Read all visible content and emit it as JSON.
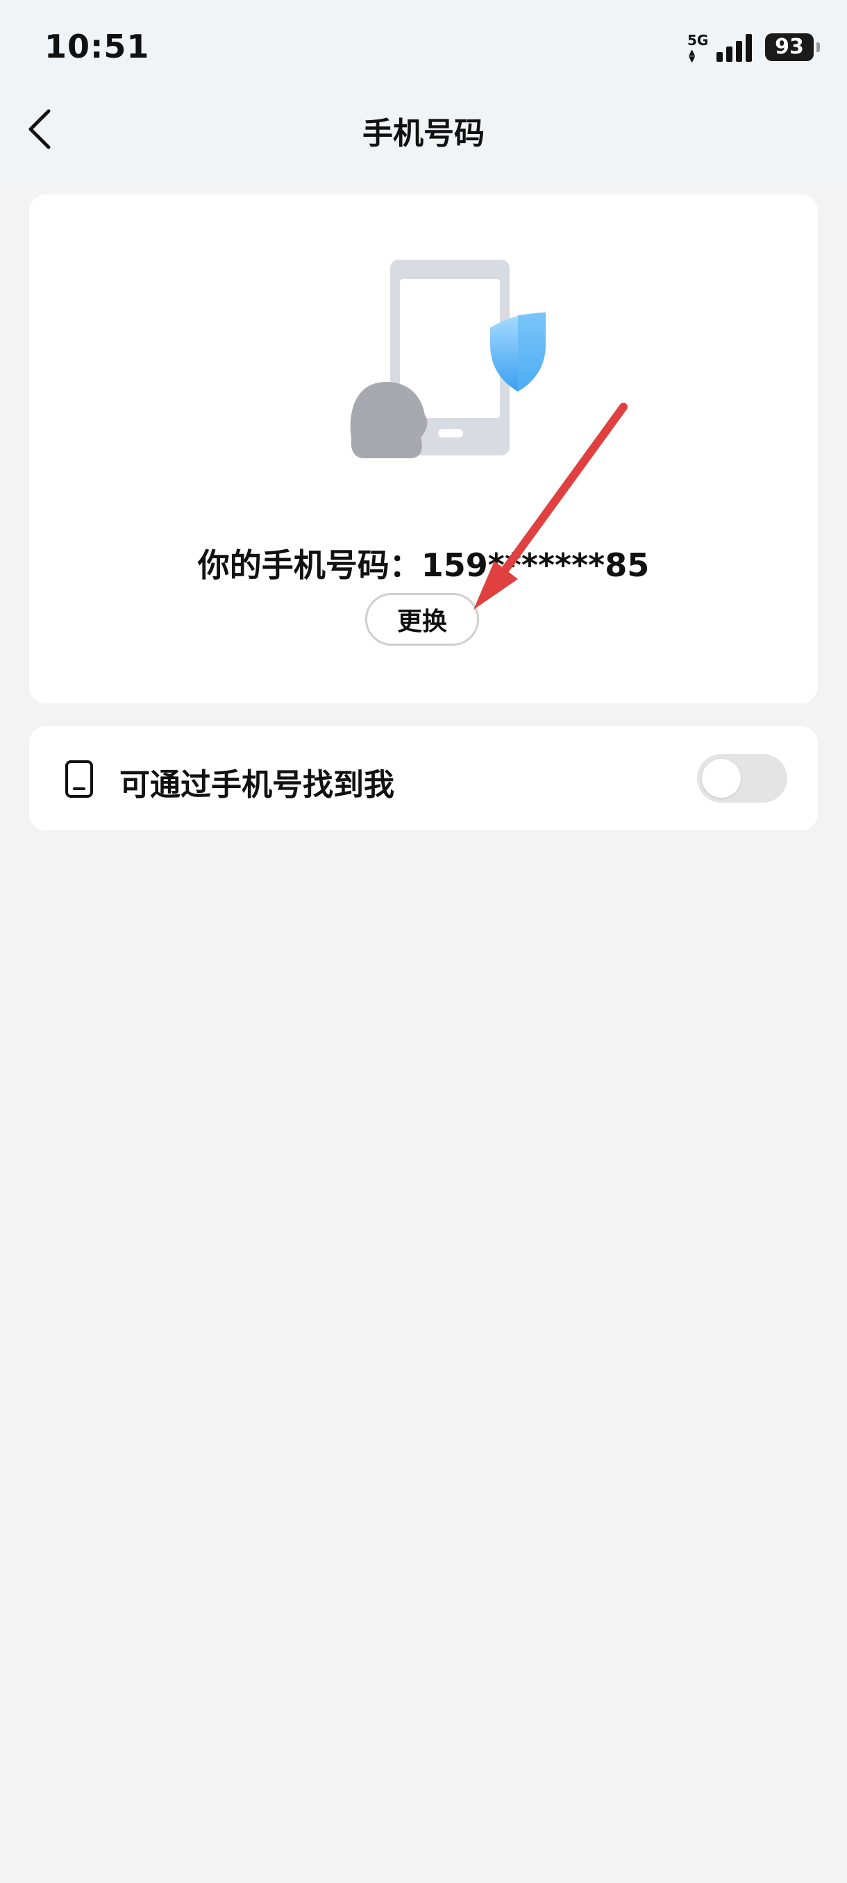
{
  "status_bar": {
    "time": "10:51",
    "network": "5G",
    "battery": "93"
  },
  "header": {
    "title": "手机号码",
    "back_icon": "chevron-left-icon"
  },
  "phone_card": {
    "illustration": "phone-shield-penguin-illustration",
    "phone_text": "你的手机号码：159*******85",
    "change_label": "更换"
  },
  "find_me": {
    "icon": "phone-icon",
    "label": "可通过手机号找到我",
    "enabled": false
  },
  "colors": {
    "page_bg": "#f3f3f3",
    "header_bg": "#f1f4f7",
    "shield": "#4aaaf5",
    "annotation_arrow": "#e0403f"
  }
}
